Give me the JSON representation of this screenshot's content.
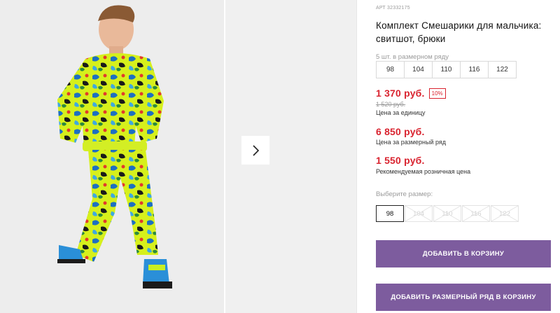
{
  "product": {
    "sku": "АРТ 32332175",
    "title": "Комплект Смешарики для мальчика: свитшот, брюки"
  },
  "pack": {
    "note": "5 шт. в размерном ряду",
    "sizes": [
      "98",
      "104",
      "110",
      "116",
      "122"
    ]
  },
  "prices": {
    "unit_price": "1 370 руб.",
    "discount": "10%",
    "old_price": "1 520 руб.",
    "unit_caption": "Цена за единицу",
    "pack_price": "6 850 руб.",
    "pack_caption": "Цена за размерный ряд",
    "retail_price": "1 550 руб.",
    "retail_caption": "Рекомендуемая розничная цена"
  },
  "size_select": {
    "label": "Выберите размер:",
    "options": [
      {
        "label": "98",
        "selected": true,
        "available": true
      },
      {
        "label": "104",
        "selected": false,
        "available": false
      },
      {
        "label": "110",
        "selected": false,
        "available": false
      },
      {
        "label": "116",
        "selected": false,
        "available": false
      },
      {
        "label": "122",
        "selected": false,
        "available": false
      }
    ]
  },
  "buttons": {
    "add_to_cart": "ДОБАВИТЬ В КОРЗИНУ",
    "add_pack_to_cart": "ДОБАВИТЬ РАЗМЕРНЫЙ РЯД В КОРЗИНУ"
  },
  "gallery": {
    "next_icon": "chevron-right-icon"
  },
  "colors": {
    "accent": "#7d5c9e",
    "price_red": "#d9232f",
    "muted": "#9a9a9a"
  }
}
